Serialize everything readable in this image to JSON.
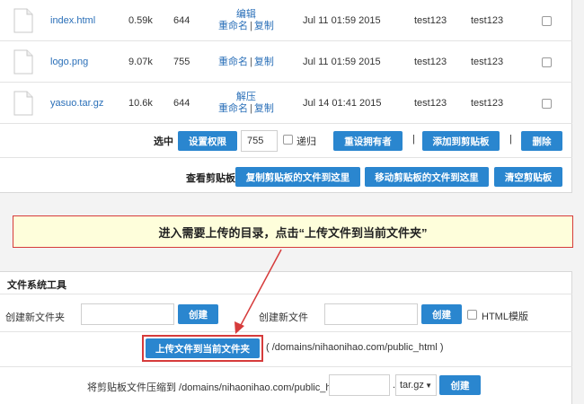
{
  "files": [
    {
      "name": "index.html",
      "size": "0.59k",
      "perm": "644",
      "actions": [
        "编辑"
      ],
      "rename": "重命名",
      "copy": "复制",
      "date": "Jul 11 01:59 2015",
      "owner": "test123",
      "group": "test123"
    },
    {
      "name": "logo.png",
      "size": "9.07k",
      "perm": "755",
      "actions": [],
      "rename": "重命名",
      "copy": "复制",
      "date": "Jul 11 01:59 2015",
      "owner": "test123",
      "group": "test123"
    },
    {
      "name": "yasuo.tar.gz",
      "size": "10.6k",
      "perm": "644",
      "actions": [
        "解压"
      ],
      "rename": "重命名",
      "copy": "复制",
      "date": "Jul 14 01:41 2015",
      "owner": "test123",
      "group": "test123"
    }
  ],
  "selected": {
    "label": "选中",
    "set_perm": "设置权限",
    "perm_value": "755",
    "recursive": "递归",
    "reset_owner": "重设拥有者",
    "add_clip": "添加到剪贴板",
    "delete": "删除",
    "sep": "|"
  },
  "clipboard": {
    "label": "查看剪贴板",
    "copy_here": "复制剪贴板的文件到这里",
    "move_here": "移动剪贴板的文件到这里",
    "clear": "清空剪贴板"
  },
  "annotation": "进入需要上传的目录，点击“上传文件到当前文件夹”",
  "tools": {
    "title": "文件系统工具",
    "new_folder_label": "创建新文件夹",
    "new_folder_btn": "创建",
    "new_file_label": "创建新文件",
    "new_file_btn": "创建",
    "html_template": "HTML模版",
    "upload_btn": "上传文件到当前文件夹",
    "upload_path": "( /domains/nihaonihao.com/public_html )",
    "compress_label": "将剪贴板文件压缩到 /domains/nihaonihao.com/public_html/",
    "compress_ext_sep": ".",
    "compress_format": "tar.gz",
    "compress_btn": "创建"
  },
  "colors": {
    "accent": "#2a86cf",
    "link": "#2a6fb8",
    "highlight_border": "#d63b3b",
    "note_bg": "#fefedb"
  }
}
